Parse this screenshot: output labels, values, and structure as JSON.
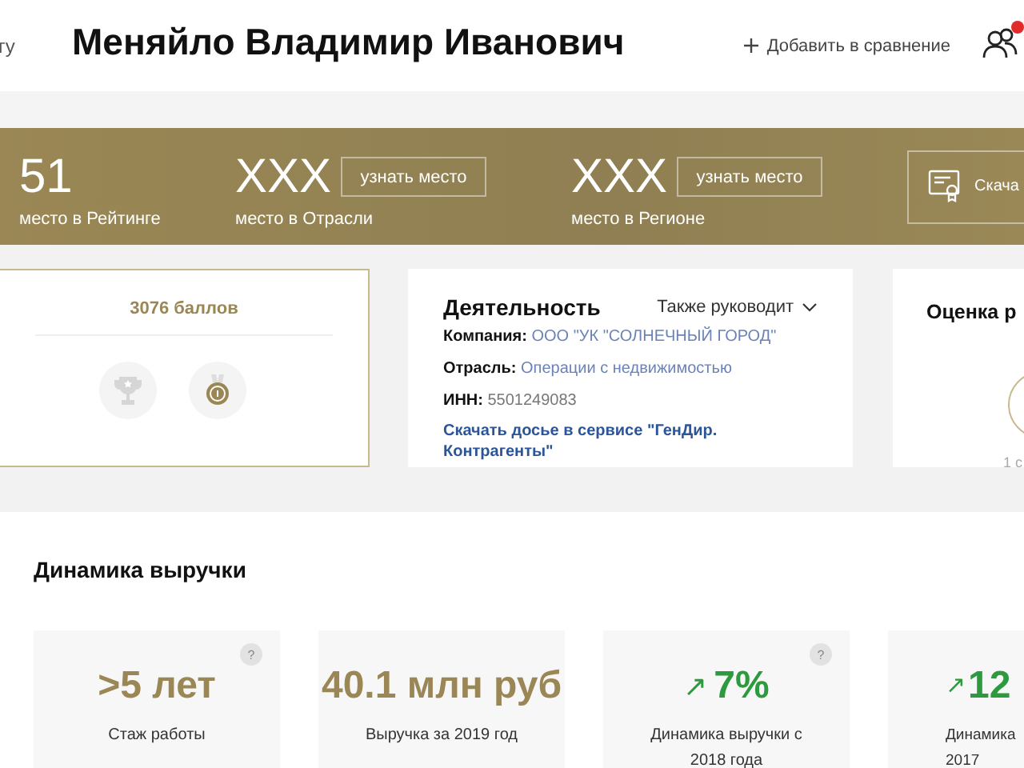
{
  "header": {
    "back_link": "гу",
    "title": "Меняйло Владимир Иванович",
    "compare_link": "Добавить в сравнение",
    "notification": true
  },
  "ranking": {
    "items": [
      {
        "value": "51",
        "label": "место в Рейтинге"
      },
      {
        "value": "XXX",
        "label": "место в Отрасли",
        "button": "узнать место"
      },
      {
        "value": "XXX",
        "label": "место в Регионе",
        "button": "узнать место"
      }
    ],
    "download": "Скача"
  },
  "score_card": {
    "points": "3076 баллов",
    "awards": [
      {
        "kind": "trophy",
        "earned": false
      },
      {
        "kind": "medal",
        "earned": true
      }
    ]
  },
  "activity": {
    "title": "Деятельность",
    "also_manages": "Также руководит",
    "fields": [
      {
        "label": "Компания:",
        "value": "ООО \"УК \"СОЛНЕЧНЫЙ ГОРОД\"",
        "link": true
      },
      {
        "label": "Отрасль:",
        "value": "Операции с недвижимостью",
        "link": true
      },
      {
        "label": "ИНН:",
        "value": "5501249083",
        "link": false
      }
    ],
    "dossier_link": "Скачать досье в сервисе \"ГенДир. Контрагенты\""
  },
  "rating_card": {
    "title": "Оценка р",
    "caption": "1 с"
  },
  "revenue": {
    "title": "Динамика выручки",
    "stats": [
      {
        "value": ">5 лет",
        "label": "Стаж работы",
        "color": "#9a8755",
        "help": "?"
      },
      {
        "value": "40.1 млн руб",
        "label": "Выручка за 2019 год",
        "color": "#9a8755"
      },
      {
        "arrow": "↗",
        "value": "7%",
        "label": "Динамика выручки с 2018 года",
        "color": "#2e9a3f",
        "help": "?"
      },
      {
        "arrow": "↗",
        "value": "12",
        "label": "Динамика 2017",
        "color": "#2e9a3f"
      }
    ]
  }
}
